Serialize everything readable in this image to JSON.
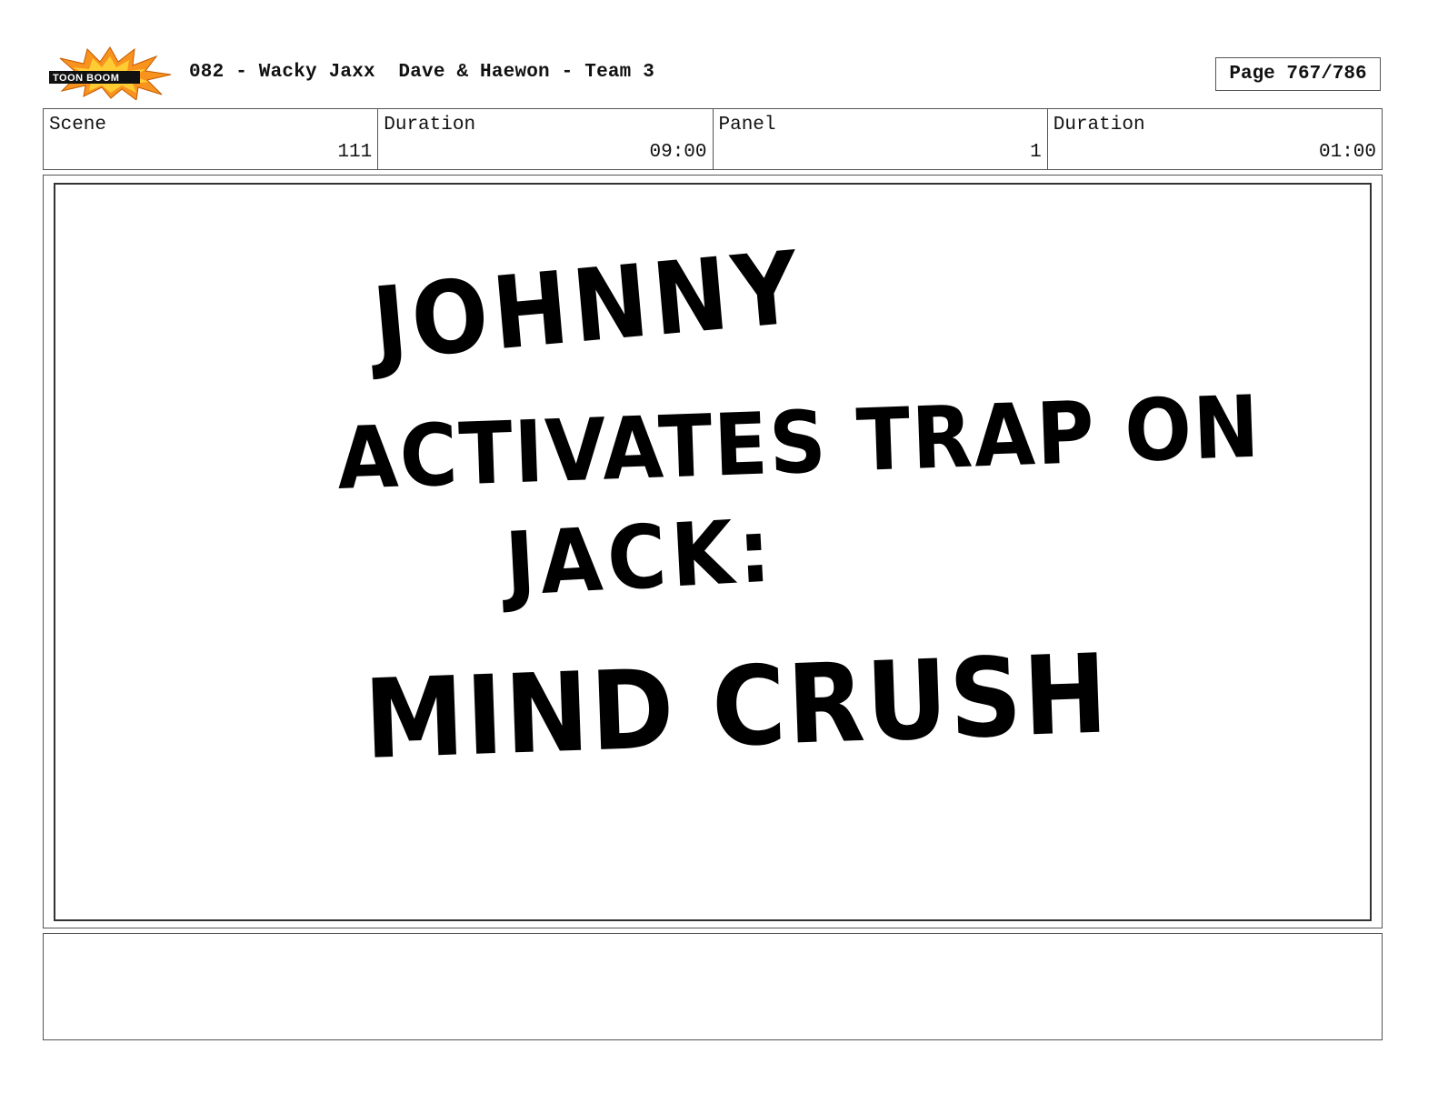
{
  "header": {
    "logo_text": "TOON BOOM",
    "title": "082 - Wacky Jaxx  Dave & Haewon - Team 3",
    "page": "Page 767/786"
  },
  "info": {
    "scene_label": "Scene",
    "scene_value": "111",
    "scene_duration_label": "Duration",
    "scene_duration_value": "09:00",
    "panel_label": "Panel",
    "panel_value": "1",
    "panel_duration_label": "Duration",
    "panel_duration_value": "01:00"
  },
  "panel": {
    "lines": [
      "JOHNNY",
      "ACTIVATES TRAP ON",
      "JACK:",
      "MIND CRUSH"
    ]
  },
  "notes": {
    "text": ""
  },
  "colors": {
    "logo_burst": "#f7931e",
    "logo_burst_inner": "#ffcc33",
    "border": "#555555",
    "ink": "#000000"
  }
}
